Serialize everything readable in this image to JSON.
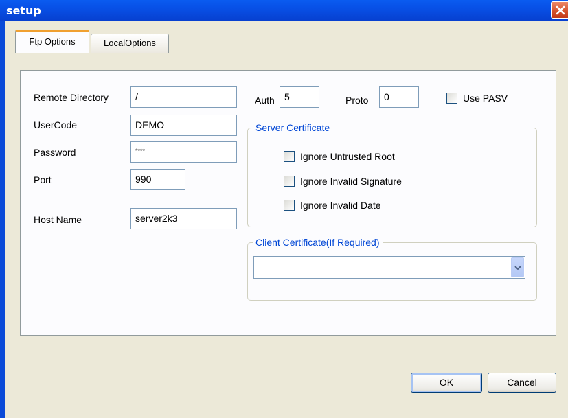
{
  "window": {
    "title": "setup"
  },
  "tabs": [
    {
      "label": "Ftp Options",
      "selected": true
    },
    {
      "label": "LocalOptions",
      "selected": false
    }
  ],
  "ftp": {
    "remote_directory": {
      "label": "Remote Directory",
      "value": "/"
    },
    "usercode": {
      "label": "UserCode",
      "value": "DEMO"
    },
    "password": {
      "label": "Password",
      "value": "****"
    },
    "port": {
      "label": "Port",
      "value": "990"
    },
    "host_name": {
      "label": "Host Name",
      "value": "server2k3"
    },
    "auth": {
      "label": "Auth",
      "value": "5"
    },
    "proto": {
      "label": "Proto",
      "value": "0"
    },
    "use_pasv": {
      "label": "Use PASV",
      "checked": false
    }
  },
  "server_certificate": {
    "title": "Server Certificate",
    "options": [
      {
        "label": "Ignore Untrusted Root",
        "checked": false
      },
      {
        "label": "Ignore Invalid Signature",
        "checked": false
      },
      {
        "label": "Ignore Invalid Date",
        "checked": false
      }
    ]
  },
  "client_certificate": {
    "title": "Client Certificate(If Required)",
    "selected": ""
  },
  "buttons": {
    "ok": "OK",
    "cancel": "Cancel"
  },
  "colors": {
    "titlebar": "#0a4ad8",
    "group_title": "#0046d5",
    "tab_accent": "#f0a030"
  }
}
